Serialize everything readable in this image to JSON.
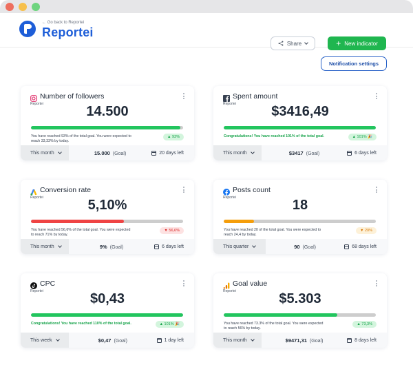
{
  "window": {
    "controls": [
      "close",
      "minimize",
      "maximize"
    ]
  },
  "header": {
    "back_link": "← Go back to Reportei",
    "brand": "Reportei",
    "share_label": "Share",
    "new_indicator_label": "New indicator"
  },
  "notification_settings_label": "Notification settings",
  "colors": {
    "brand": "#1e5ed8",
    "success": "#1fb64f",
    "danger": "#e53935",
    "warning": "#f59e0b",
    "track": "#cdcdcd"
  },
  "cards": [
    {
      "title": "Number of followers",
      "icon": "instagram-icon",
      "source": "Reportei",
      "value": "14.500",
      "progress": 0.98,
      "bar_color": "#22c55e",
      "message": "You have reached 93% of the total goal. You were expected to reach 33,33% by today.",
      "message_type": "normal",
      "badge": "▲ 93%",
      "badge_type": "up",
      "period": "This month",
      "goal_value": "15.000",
      "goal_label": "(Goal)",
      "days_left": "20 days left"
    },
    {
      "title": "Spent amount",
      "icon": "facebook-square-icon",
      "source": "Reportei",
      "value": "$3416,49",
      "progress": 1.0,
      "bar_color": "#22c55e",
      "message": "Congratulations! You have reached 101% of the total goal.",
      "message_type": "success",
      "badge": "▲ 101% 🎉",
      "badge_type": "up",
      "period": "This month",
      "goal_value": "$3417",
      "goal_label": "(Goal)",
      "days_left": "6 days left"
    },
    {
      "title": "Conversion rate",
      "icon": "google-ads-icon",
      "source": "Reportei",
      "value": "5,10%",
      "progress": 0.61,
      "bar_color": "#ef4444",
      "message": "You have reached 56,6% of the total goal. You were expected to reach 71% by today.",
      "message_type": "normal",
      "badge": "▼ 56,6%",
      "badge_type": "down",
      "period": "This month",
      "goal_value": "9%",
      "goal_label": "(Goal)",
      "days_left": "6 days left"
    },
    {
      "title": "Posts count",
      "icon": "facebook-circle-icon",
      "source": "Reportei",
      "value": "18",
      "progress": 0.2,
      "bar_color": "#f59e0b",
      "message": "You have reached 20 of the total goal. You were expected to reach 24,4 by today.",
      "message_type": "normal",
      "badge": "▼ 20%",
      "badge_type": "warn",
      "period": "This quarter",
      "goal_value": "90",
      "goal_label": "(Goal)",
      "days_left": "68 days left"
    },
    {
      "title": "CPC",
      "icon": "tiktok-icon",
      "source": "Reportei",
      "value": "$0,43",
      "progress": 1.0,
      "bar_color": "#22c55e",
      "message": "Congratulations! You have reached 110% of the total goal.",
      "message_type": "success",
      "badge": "▲ 101% 🎉",
      "badge_type": "up",
      "period": "This week",
      "goal_value": "$0,47",
      "goal_label": "(Goal)",
      "days_left": "1 day left"
    },
    {
      "title": "Goal value",
      "icon": "google-analytics-icon",
      "source": "Reportei",
      "value": "$5.303",
      "progress": 0.745,
      "bar_color": "#22c55e",
      "message": "You have reached 73.3% of the total goal. You were expected to reach 56% by today.",
      "message_type": "normal",
      "badge": "▲ 73,3%",
      "badge_type": "up",
      "period": "This month",
      "goal_value": "$9471,31",
      "goal_label": "(Goal)",
      "days_left": "8 days left"
    }
  ]
}
